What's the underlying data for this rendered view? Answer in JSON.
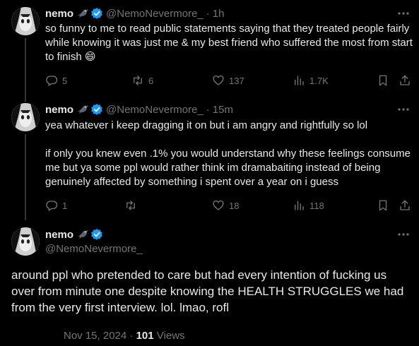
{
  "tweets": [
    {
      "name": "nemo",
      "handle": "@NemoNevermore_",
      "time": "1h",
      "text": "so funny to me to read public statements saying that they treated people fairly while knowing it was just me & my best friend who suffered the most from start to finish 😄",
      "stats": {
        "replies": "5",
        "reposts": "6",
        "likes": "137",
        "views": "1.7K"
      }
    },
    {
      "name": "nemo",
      "handle": "@NemoNevermore_",
      "time": "15m",
      "text": "yea whatever i keep dragging it on but i am angry and rightfully so lol\n\nif only you knew even .1% you would understand why these feelings consume me but ya some ppl would rather think im dramabaiting instead of being genuinely affected by something i spent over a year on i guess",
      "stats": {
        "replies": "1",
        "reposts": "",
        "likes": "18",
        "views": "118"
      }
    }
  ],
  "main_tweet": {
    "name": "nemo",
    "handle": "@NemoNevermore_",
    "text": "around ppl who pretended to care but had every intention of fucking us over from minute one despite knowing the HEALTH STRUGGLES we had from the very first interview. lol. lmao, rofl",
    "date": "Nov 15, 2024",
    "separator": "·",
    "views_count": "101",
    "views_label": "Views"
  },
  "dot": "·",
  "colors": {
    "background": "#000000",
    "text": "#e7e9ea",
    "muted": "#71767b",
    "verified": "#1d9bf0"
  }
}
